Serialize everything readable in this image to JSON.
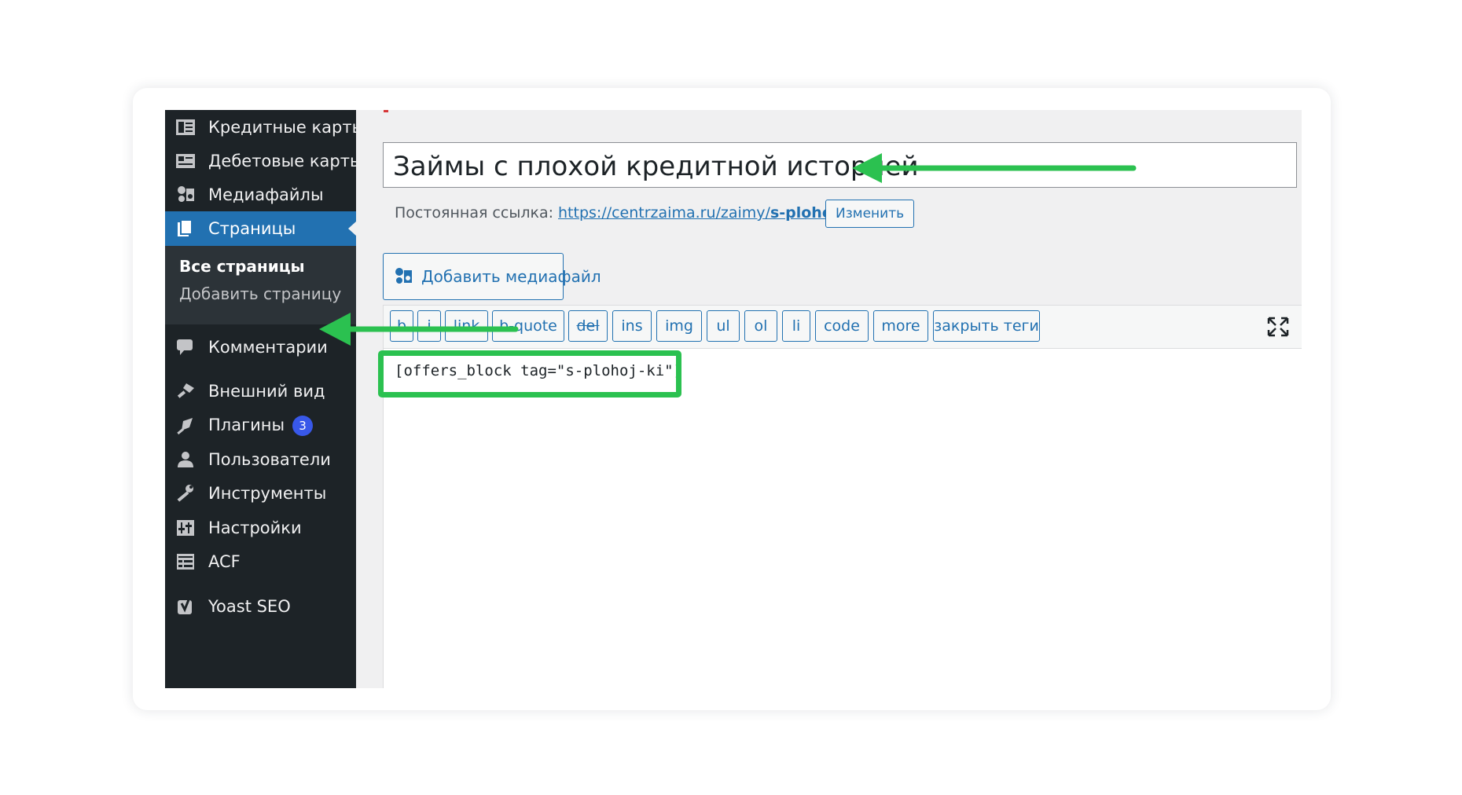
{
  "sidebar": {
    "items": [
      {
        "label": "Кредитные карты",
        "icon": "credit-cards-icon"
      },
      {
        "label": "Дебетовые карты",
        "icon": "debit-cards-icon"
      },
      {
        "label": "Медиафайлы",
        "icon": "media-icon"
      },
      {
        "label": "Страницы",
        "icon": "pages-icon"
      },
      {
        "label": "Комментарии",
        "icon": "comments-icon"
      },
      {
        "label": "Внешний вид",
        "icon": "appearance-icon"
      },
      {
        "label": "Плагины",
        "icon": "plugins-icon",
        "badge": "3"
      },
      {
        "label": "Пользователи",
        "icon": "users-icon"
      },
      {
        "label": "Инструменты",
        "icon": "tools-icon"
      },
      {
        "label": "Настройки",
        "icon": "settings-icon"
      },
      {
        "label": "ACF",
        "icon": "acf-icon"
      },
      {
        "label": "Yoast SEO",
        "icon": "yoast-icon"
      }
    ],
    "submenu": {
      "all_pages": "Все страницы",
      "add_page": "Добавить страницу"
    }
  },
  "editor": {
    "title": "Займы с плохой кредитной историей",
    "permalink_label": "Постоянная ссылка:",
    "permalink_url_base": "https://centrzaima.ru/zaimy/",
    "permalink_slug": "s-plohoj-ki",
    "permalink_trailing": "/",
    "change_button": "Изменить",
    "add_media_button": "Добавить медиафайл",
    "quicktags": [
      "b",
      "i",
      "link",
      "b-quote",
      "del",
      "ins",
      "img",
      "ul",
      "ol",
      "li",
      "code",
      "more",
      "закрыть теги"
    ],
    "content": "[offers_block tag=\"s-plohoj-ki\"]"
  },
  "colors": {
    "sidebar_bg": "#1d2327",
    "active_menu": "#2271b1",
    "link": "#2271b1",
    "annotation_green": "#2bc150",
    "badge": "#3858e9"
  }
}
